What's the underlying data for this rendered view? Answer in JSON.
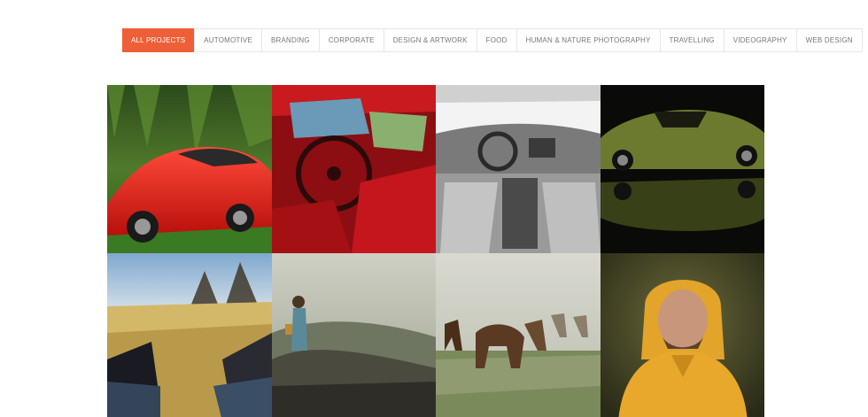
{
  "accent_color": "#ef5f37",
  "filters": [
    {
      "label": "ALL PROJECTS",
      "active": true
    },
    {
      "label": "AUTOMOTIVE",
      "active": false
    },
    {
      "label": "BRANDING",
      "active": false
    },
    {
      "label": "CORPORATE",
      "active": false
    },
    {
      "label": "DESIGN & ARTWORK",
      "active": false
    },
    {
      "label": "FOOD",
      "active": false
    },
    {
      "label": "HUMAN & NATURE PHOTOGRAPHY",
      "active": false
    },
    {
      "label": "TRAVELLING",
      "active": false
    },
    {
      "label": "VIDEOGRAPHY",
      "active": false
    },
    {
      "label": "WEB DESIGN",
      "active": false
    }
  ],
  "portfolio_items": [
    {
      "subject": "red-sports-car"
    },
    {
      "subject": "red-car-interior"
    },
    {
      "subject": "grey-car-interior"
    },
    {
      "subject": "green-muscle-car"
    },
    {
      "subject": "sneakers-field"
    },
    {
      "subject": "girl-on-rocks"
    },
    {
      "subject": "horses-running"
    },
    {
      "subject": "man-yellow-hoodie"
    }
  ]
}
